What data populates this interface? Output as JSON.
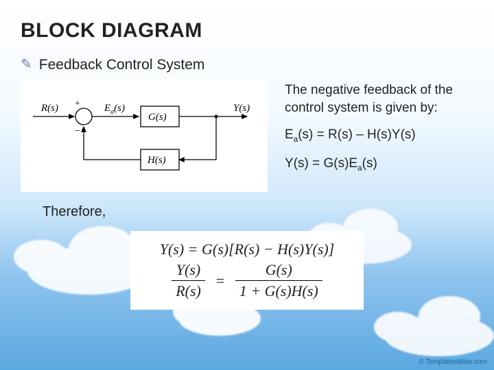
{
  "title": "BLOCK DIAGRAM",
  "subtitle": "Feedback Control System",
  "diagram": {
    "input": "R(s)",
    "error": "E",
    "error_sub": "a",
    "error_suffix": "(s)",
    "block_forward": "G(s)",
    "block_feedback": "H(s)",
    "output": "Y(s)",
    "sum_plus": "+",
    "sum_minus": "−"
  },
  "description": "The negative feedback of the control system is given by:",
  "eq1": {
    "lhs_pre": "E",
    "lhs_sub": "a",
    "lhs_post": "(s) = R(s) – H(s)Y(s)"
  },
  "eq2": {
    "pre": "Y(s) = G(s)E",
    "sub": "a",
    "post": "(s)"
  },
  "therefore": "Therefore,",
  "derivation": {
    "line1": "Y(s) = G(s)[R(s) − H(s)Y(s)]",
    "frac_lhs_num": "Y(s)",
    "frac_lhs_den": "R(s)",
    "frac_rhs_num": "G(s)",
    "frac_rhs_den": "1 + G(s)H(s)",
    "equals": "="
  },
  "watermark": "© TemplatesWise.com"
}
